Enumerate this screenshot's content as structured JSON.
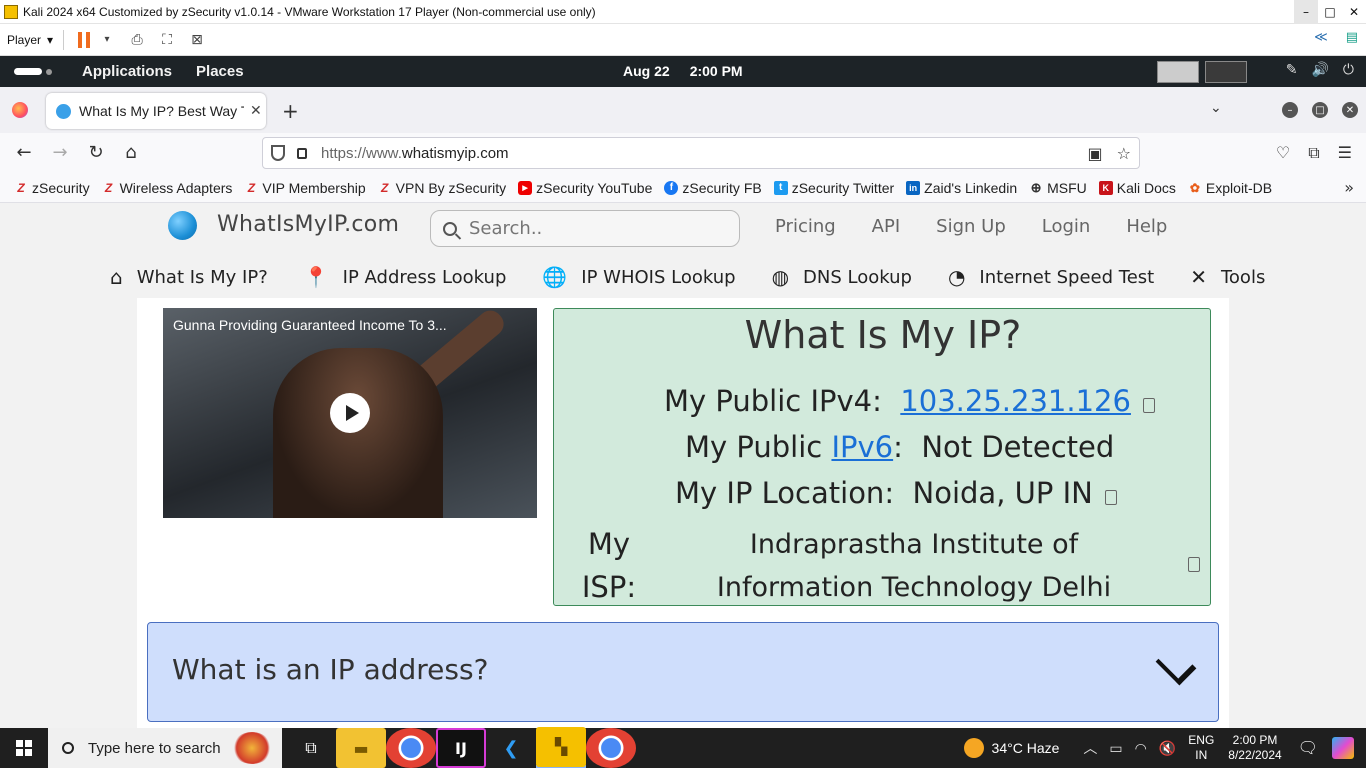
{
  "vmware": {
    "title": "Kali 2024 x64 Customized by zSecurity v1.0.14 - VMware Workstation 17 Player (Non-commercial use only)",
    "player_label": "Player"
  },
  "kali_panel": {
    "applications": "Applications",
    "places": "Places",
    "date": "Aug 22",
    "time": "2:00 PM"
  },
  "firefox": {
    "tab_title": "What Is My IP? Best Way To",
    "url_prefix": "https://www.",
    "url_domain": "whatismyip.com",
    "bookmarks": [
      {
        "label": "zSecurity",
        "icon": "z-icon"
      },
      {
        "label": "Wireless Adapters",
        "icon": "z-icon"
      },
      {
        "label": "VIP Membership",
        "icon": "z-icon"
      },
      {
        "label": "VPN By zSecurity",
        "icon": "z-icon"
      },
      {
        "label": "zSecurity YouTube",
        "icon": "youtube-icon"
      },
      {
        "label": "zSecurity FB",
        "icon": "facebook-icon"
      },
      {
        "label": "zSecurity Twitter",
        "icon": "twitter-icon"
      },
      {
        "label": "Zaid's Linkedin",
        "icon": "linkedin-icon"
      },
      {
        "label": "MSFU",
        "icon": "globe-icon"
      },
      {
        "label": "Kali Docs",
        "icon": "kali-icon"
      },
      {
        "label": "Exploit-DB",
        "icon": "exploitdb-icon"
      }
    ]
  },
  "site": {
    "name": "WhatIsMyIP.com",
    "search_placeholder": "Search..",
    "top_links": [
      "Pricing",
      "API",
      "Sign Up",
      "Login",
      "Help"
    ],
    "nav": [
      {
        "label": "What Is My IP?",
        "icon": "home-icon"
      },
      {
        "label": "IP Address Lookup",
        "icon": "map-pin-icon"
      },
      {
        "label": "IP WHOIS Lookup",
        "icon": "globe-icon"
      },
      {
        "label": "DNS Lookup",
        "icon": "dns-icon"
      },
      {
        "label": "Internet Speed Test",
        "icon": "speedometer-icon"
      },
      {
        "label": "Tools",
        "icon": "tools-icon"
      }
    ],
    "video_title": "Gunna Providing Guaranteed Income To 3...",
    "ip_box": {
      "heading": "What Is My IP?",
      "ipv4_label": "My Public IPv4:",
      "ipv4_value": "103.25.231.126",
      "ipv6_label_pre": "My Public",
      "ipv6_link": "IPv6",
      "ipv6_label_post": ":",
      "ipv6_value": "Not Detected",
      "location_label": "My IP Location:",
      "location_value": "Noida, UP IN",
      "isp_label": "My ISP:",
      "isp_value": "Indraprastha Institute of Information Technology Delhi"
    },
    "faq_question": "What is an IP address?"
  },
  "taskbar": {
    "search_placeholder": "Type here to search",
    "weather": "34°C  Haze",
    "lang_line1": "ENG",
    "lang_line2": "IN",
    "time": "2:00 PM",
    "date": "8/22/2024"
  }
}
